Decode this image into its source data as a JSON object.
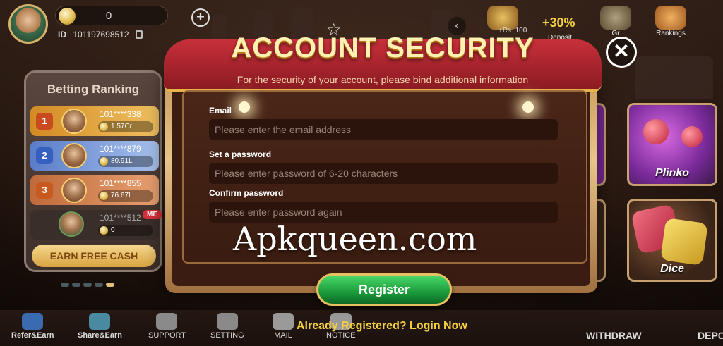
{
  "profile": {
    "balance": "0",
    "id_label": "ID",
    "id_value": "101197698512",
    "add_symbol": "+"
  },
  "ranking": {
    "title": "Betting Ranking",
    "rows": [
      {
        "rank": "1",
        "name": "101****338",
        "amount": "1.57Cr"
      },
      {
        "rank": "2",
        "name": "101****879",
        "amount": "80.91L"
      },
      {
        "rank": "3",
        "name": "101****855",
        "amount": "76.67L"
      },
      {
        "rank": "",
        "name": "101****512",
        "amount": "0",
        "badge": "ME"
      }
    ],
    "earn_button": "EARN FREE CASH"
  },
  "top_bar": {
    "rs_text": "+Rs. 100",
    "pct_text": "+30%",
    "deposit_label": "Deposit",
    "gr_label": "Gr",
    "rankings_label": "Rankings"
  },
  "dialog": {
    "title": "ACCOUNT SECURITY",
    "subtitle": "For the security of your account, please bind additional information",
    "fields": {
      "email_label": "Email",
      "email_placeholder": "Please enter the email address",
      "password_label": "Set a password",
      "password_placeholder": "Please enter password of 6-20 characters",
      "confirm_label": "Confirm password",
      "confirm_placeholder": "Please enter password again"
    },
    "register_button": "Register",
    "login_link": "Already Registered? Login Now",
    "close_symbol": "✕"
  },
  "watermark": "Apkqueen.com",
  "games": {
    "plinko": "Plinko",
    "dice": "Dice"
  },
  "bottom_nav": {
    "items": [
      {
        "label": "Refer&Earn"
      },
      {
        "label": "Share&Earn"
      },
      {
        "label": "SUPPORT"
      },
      {
        "label": "SETTING"
      },
      {
        "label": "MAIL"
      },
      {
        "label": "NOTICE"
      }
    ],
    "withdraw": "WITHDRAW",
    "deposit": "DEPO"
  },
  "colors": {
    "accent_gold": "#f4d040",
    "banner_red": "#c8303a",
    "register_green": "#1a9a3a"
  }
}
